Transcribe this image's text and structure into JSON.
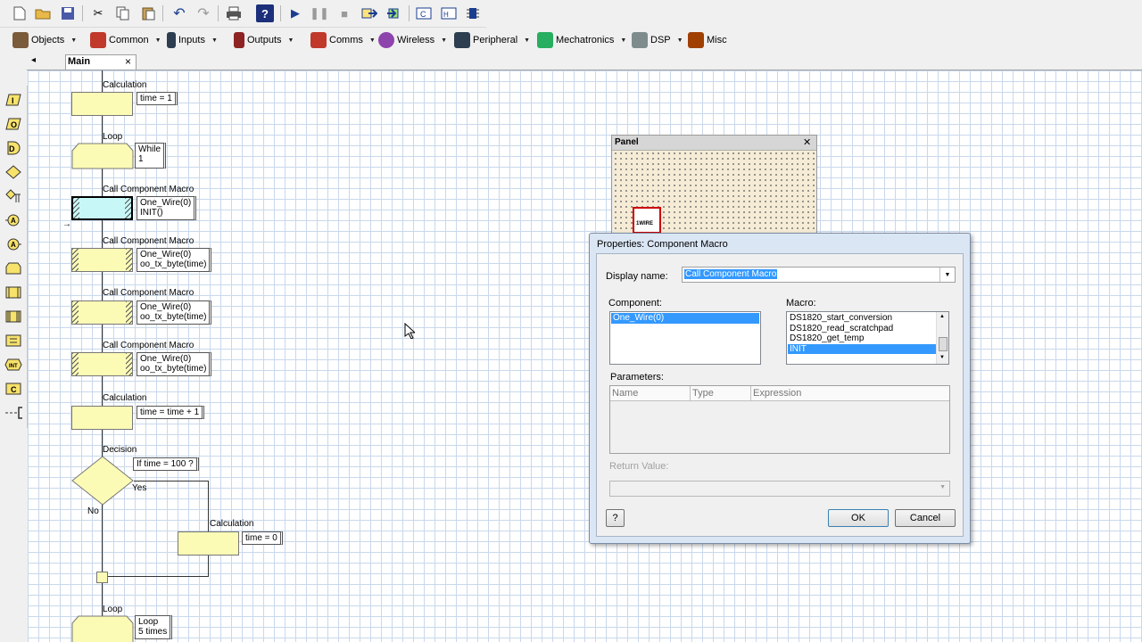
{
  "toolbar_top": {
    "icons": [
      "new-file-icon",
      "open-folder-icon",
      "save-icon",
      "cut-icon",
      "copy-icon",
      "paste-icon",
      "undo-icon",
      "redo-icon",
      "print-icon",
      "help-icon",
      "run-icon",
      "pause-icon",
      "stop-icon",
      "step-into-icon",
      "step-over-icon",
      "compile-c-icon",
      "compile-hex-icon",
      "compile-chip-icon"
    ]
  },
  "toolbar_components": {
    "categories": [
      {
        "label": "Objects",
        "color": "#7a5b3a"
      },
      {
        "label": "Common",
        "color": "#c0392b"
      },
      {
        "label": "Inputs",
        "color": "#2c3e50"
      },
      {
        "label": "Outputs",
        "color": "#8e2323"
      },
      {
        "label": "Comms",
        "color": "#c0392b"
      },
      {
        "label": "Wireless",
        "color": "#8e44ad"
      },
      {
        "label": "Peripheral",
        "color": "#2c3e50"
      },
      {
        "label": "Mechatronics",
        "color": "#27ae60"
      },
      {
        "label": "DSP",
        "color": "#7f8c8d"
      },
      {
        "label": "Misc",
        "color": "#a04000"
      }
    ]
  },
  "tabs": {
    "main_label": "Main",
    "close": "×",
    "nav": "◂"
  },
  "flowchart": {
    "calc1": {
      "title": "Calculation",
      "note": "time = 1"
    },
    "loop1": {
      "title": "Loop",
      "note1": "While",
      "note2": "1"
    },
    "macro1": {
      "title": "Call Component Macro",
      "note1": "One_Wire(0)",
      "note2": "INIT()"
    },
    "macro2": {
      "title": "Call Component Macro",
      "note1": "One_Wire(0)",
      "note2": "oo_tx_byte(time)"
    },
    "macro3": {
      "title": "Call Component Macro",
      "note1": "One_Wire(0)",
      "note2": "oo_tx_byte(time)"
    },
    "macro4": {
      "title": "Call Component Macro",
      "note1": "One_Wire(0)",
      "note2": "oo_tx_byte(time)"
    },
    "calc2": {
      "title": "Calculation",
      "note": "time = time + 1"
    },
    "decision": {
      "title": "Decision",
      "note": "If  time = 100 ?",
      "yes": "Yes",
      "no": "No"
    },
    "calc3": {
      "title": "Calculation",
      "note": "time = 0"
    },
    "loop2": {
      "title": "Loop",
      "note1": "Loop",
      "note2": "5 times"
    }
  },
  "panel": {
    "title": "Panel",
    "close": "✕",
    "component_label": "1WIRE"
  },
  "dialog": {
    "title": "Properties: Component Macro",
    "display_name_label": "Display name:",
    "display_name_value": "Call Component Macro",
    "component_label": "Component:",
    "components": [
      "One_Wire(0)"
    ],
    "macro_label": "Macro:",
    "macros": [
      "DS1820_start_conversion",
      "DS1820_read_scratchpad",
      "DS1820_get_temp",
      "INIT"
    ],
    "parameters_label": "Parameters:",
    "columns": [
      "Name",
      "Type",
      "Expression"
    ],
    "return_label": "Return Value:",
    "help_label": "?",
    "ok_label": "OK",
    "cancel_label": "Cancel"
  }
}
